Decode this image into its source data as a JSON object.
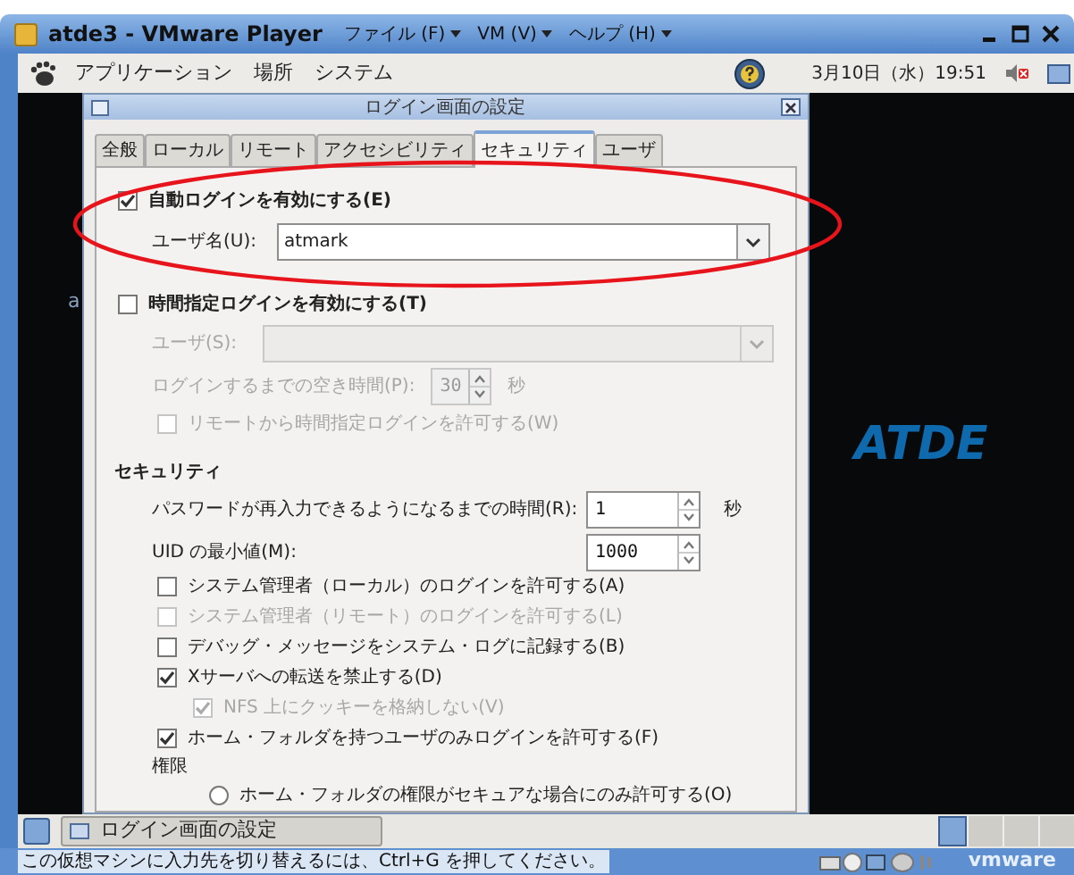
{
  "window": {
    "title": "atde3 - VMware Player",
    "menus": [
      "ファイル (F)",
      "VM (V)",
      "ヘルプ (H)"
    ]
  },
  "panel": {
    "menus": [
      "アプリケーション",
      "場所",
      "システム"
    ],
    "clock": "3月10日（水）19:51"
  },
  "desktop": {
    "edge_text": "a",
    "logo": "ATDE"
  },
  "dialog": {
    "title": "ログイン画面の設定",
    "tabs": [
      {
        "label": "全般",
        "selected": false
      },
      {
        "label": "ローカル",
        "selected": false
      },
      {
        "label": "リモート",
        "selected": false
      },
      {
        "label": "アクセシビリティ",
        "selected": false
      },
      {
        "label": "セキュリティ",
        "selected": true
      },
      {
        "label": "ユーザ",
        "selected": false
      }
    ],
    "auto_login": {
      "label": "自動ログインを有効にする(E)",
      "checked": true,
      "user_label": "ユーザ名(U):",
      "user_value": "atmark"
    },
    "timed_login": {
      "label": "時間指定ログインを有効にする(T)",
      "checked": false,
      "user_label": "ユーザ(S):",
      "delay_label": "ログインするまでの空き時間(P):",
      "delay_value": "30",
      "delay_unit": "秒",
      "remote": {
        "label": "リモートから時間指定ログインを許可する(W)",
        "checked": false
      }
    },
    "security": {
      "heading": "セキュリティ",
      "retry_label": "パスワードが再入力できるようになるまでの時間(R):",
      "retry_value": "1",
      "retry_unit": "秒",
      "uid_label": "UID の最小値(M):",
      "uid_value": "1000",
      "options": [
        {
          "label": "システム管理者（ローカル）のログインを許可する(A)",
          "checked": false,
          "disabled": false
        },
        {
          "label": "システム管理者（リモート）のログインを許可する(L)",
          "checked": false,
          "disabled": true
        },
        {
          "label": "デバッグ・メッセージをシステム・ログに記録する(B)",
          "checked": false,
          "disabled": false
        },
        {
          "label": "Xサーバへの転送を禁止する(D)",
          "checked": true,
          "disabled": false,
          "children": [
            {
              "label": "NFS 上にクッキーを格納しない(V)",
              "checked": true,
              "disabled": true
            }
          ]
        },
        {
          "label": "ホーム・フォルダを持つユーザのみログインを許可する(F)",
          "checked": true,
          "disabled": false
        }
      ],
      "permissions_heading": "権限",
      "radio": {
        "label": "ホーム・フォルダの権限がセキュアな場合にのみ許可する(O)",
        "selected": false
      }
    }
  },
  "taskbar": {
    "button": "ログイン画面の設定"
  },
  "status_bar": {
    "message": "この仮想マシンに入力先を切り替えるには、Ctrl+G を押してください。",
    "logo": "vmware"
  }
}
